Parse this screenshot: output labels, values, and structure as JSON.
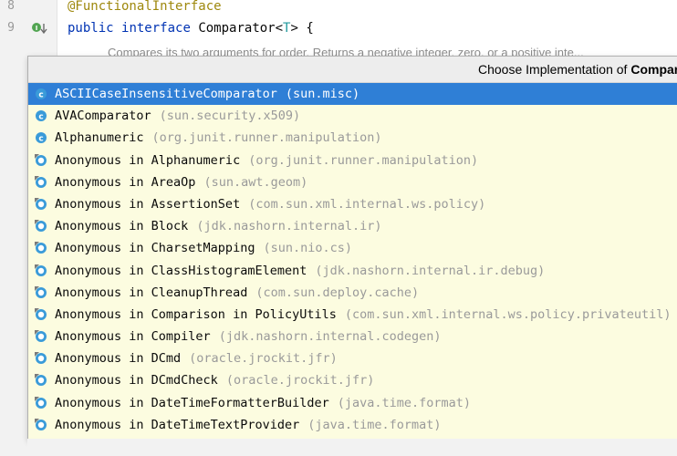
{
  "editor": {
    "lines": [
      {
        "number": "8",
        "annotation": "@FunctionalInterface"
      },
      {
        "number": "9",
        "kw1": "public",
        "kw2": "interface",
        "name": "Comparator<",
        "tparam": "T",
        "rest": "> {"
      }
    ],
    "doc_fragment": "Compares its two arguments for order. Returns a negative integer, zero, or a positive inte..."
  },
  "popup": {
    "title_prefix": "Choose Implementation of ",
    "title_bold": "Compar",
    "items": [
      {
        "label": "ASCIICaseInsensitiveComparator",
        "package": "(sun.misc)",
        "icon": "class-icon",
        "selected": true
      },
      {
        "label": "AVAComparator",
        "package": "(sun.security.x509)",
        "icon": "class-icon"
      },
      {
        "label": "Alphanumeric",
        "package": "(org.junit.runner.manipulation)",
        "icon": "class-icon"
      },
      {
        "label": "Anonymous in Alphanumeric",
        "package": "(org.junit.runner.manipulation)",
        "icon": "anonymous-class-icon"
      },
      {
        "label": "Anonymous in AreaOp",
        "package": "(sun.awt.geom)",
        "icon": "anonymous-class-icon"
      },
      {
        "label": "Anonymous in AssertionSet",
        "package": "(com.sun.xml.internal.ws.policy)",
        "icon": "anonymous-class-icon"
      },
      {
        "label": "Anonymous in Block",
        "package": "(jdk.nashorn.internal.ir)",
        "icon": "anonymous-class-icon"
      },
      {
        "label": "Anonymous in CharsetMapping",
        "package": "(sun.nio.cs)",
        "icon": "anonymous-class-icon"
      },
      {
        "label": "Anonymous in ClassHistogramElement",
        "package": "(jdk.nashorn.internal.ir.debug)",
        "icon": "anonymous-class-icon"
      },
      {
        "label": "Anonymous in CleanupThread",
        "package": "(com.sun.deploy.cache)",
        "icon": "anonymous-class-icon"
      },
      {
        "label": "Anonymous in Comparison in PolicyUtils",
        "package": "(com.sun.xml.internal.ws.policy.privateutil)",
        "icon": "anonymous-class-icon"
      },
      {
        "label": "Anonymous in Compiler",
        "package": "(jdk.nashorn.internal.codegen)",
        "icon": "anonymous-class-icon"
      },
      {
        "label": "Anonymous in DCmd",
        "package": "(oracle.jrockit.jfr)",
        "icon": "anonymous-class-icon"
      },
      {
        "label": "Anonymous in DCmdCheck",
        "package": "(oracle.jrockit.jfr)",
        "icon": "anonymous-class-icon"
      },
      {
        "label": "Anonymous in DateTimeFormatterBuilder",
        "package": "(java.time.format)",
        "icon": "anonymous-class-icon"
      },
      {
        "label": "Anonymous in DateTimeTextProvider",
        "package": "(java.time.format)",
        "icon": "anonymous-class-icon"
      }
    ]
  },
  "colors": {
    "selection": "#2f7fd6",
    "popup_bg": "#fcfce0",
    "icon_blue": "#3a9bd9"
  }
}
